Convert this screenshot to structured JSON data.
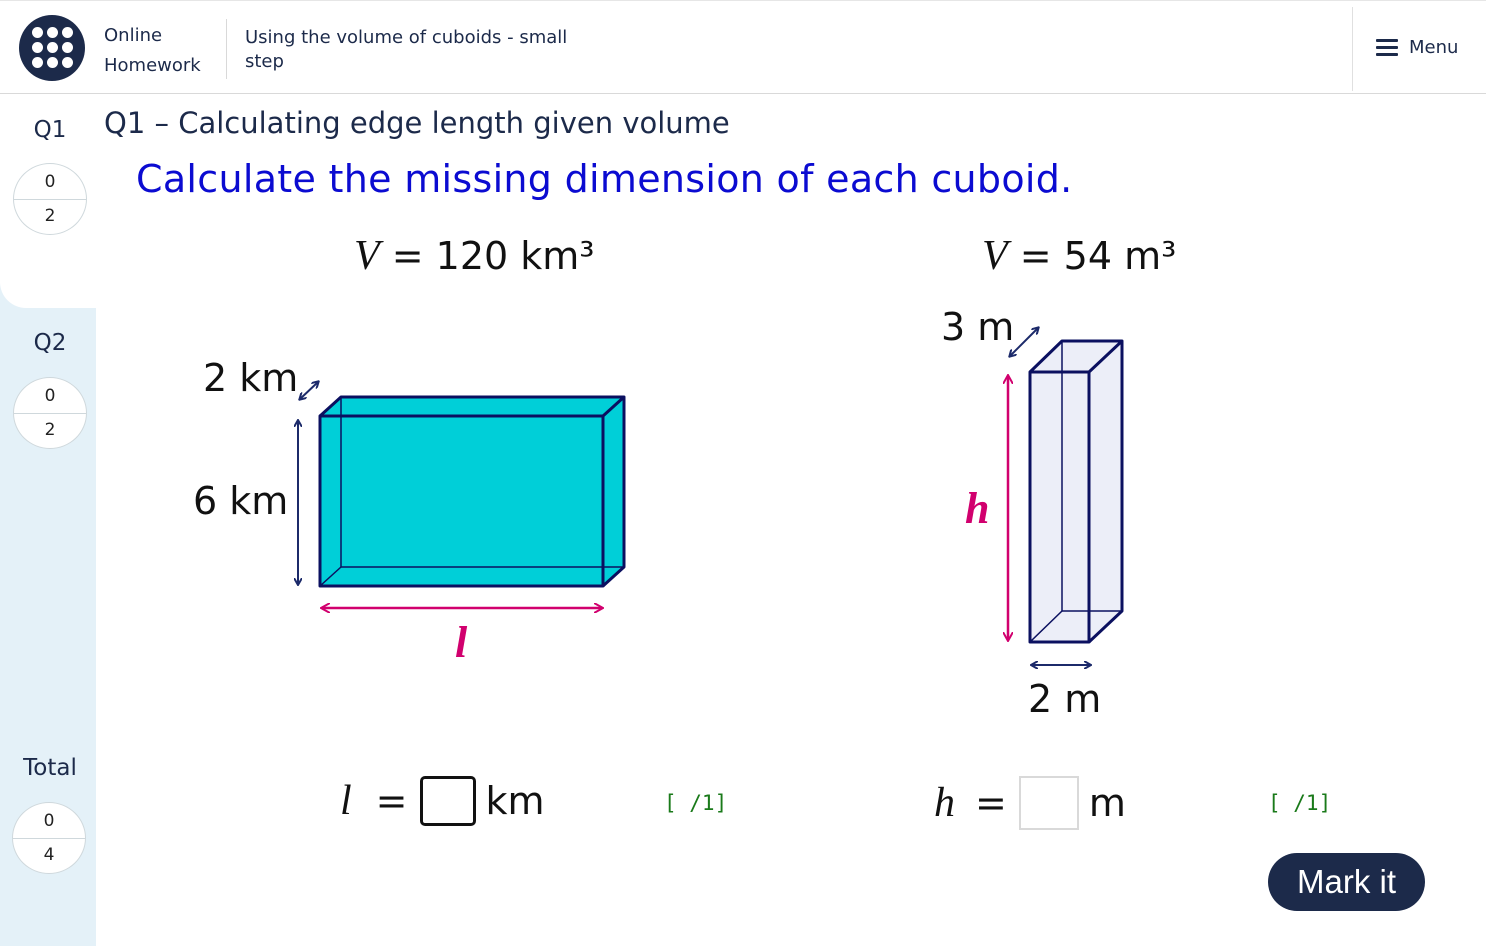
{
  "header": {
    "brand_line1": "Online",
    "brand_line2": "Homework",
    "step_title": "Using the volume of cuboids - small step",
    "menu_label": "Menu"
  },
  "sidebar": {
    "q1": {
      "label": "Q1",
      "score": "0",
      "max": "2"
    },
    "q2": {
      "label": "Q2",
      "score": "0",
      "max": "2"
    },
    "total": {
      "label": "Total",
      "score": "0",
      "max": "4"
    }
  },
  "question": {
    "heading": "Q1 – Calculating edge length given volume",
    "instruction": "Calculate the missing dimension of each cuboid."
  },
  "cuboid1": {
    "volume_var": "V",
    "volume_value": "= 120 km³",
    "depth_label": "2 km",
    "height_label": "6 km",
    "unknown_label": "l",
    "answer_var": "l",
    "answer_eq": "=",
    "answer_unit": "km",
    "marks": "[ /1]",
    "fill_color": "#00cfd8"
  },
  "cuboid2": {
    "volume_var": "V",
    "volume_value": "= 54 m³",
    "depth_label": "3 m",
    "width_label": "2 m",
    "unknown_label": "h",
    "answer_var": "h",
    "answer_eq": "=",
    "answer_unit": "m",
    "marks": "[ /1]",
    "fill_color": "#eceef8"
  },
  "mark_button": "Mark it",
  "colors": {
    "navy": "#1c2a4a",
    "accent_text": "#0b0bd1",
    "unknown": "#d1006e",
    "sidebar": "#e4f1f8"
  }
}
